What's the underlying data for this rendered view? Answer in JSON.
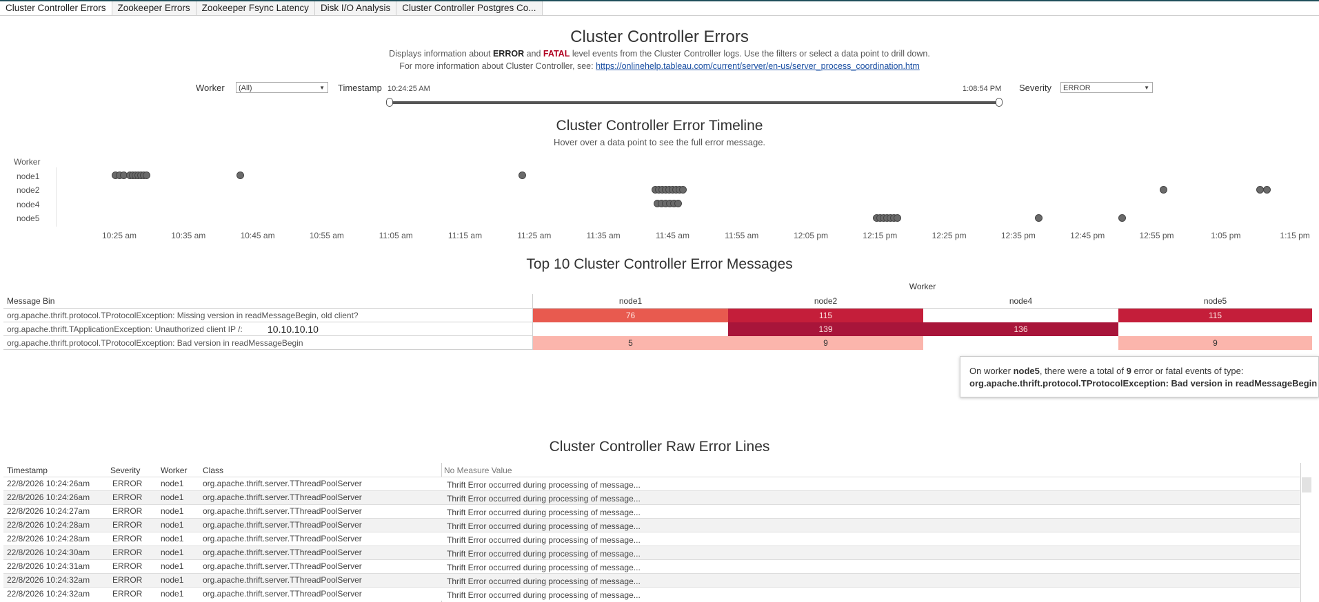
{
  "tabs": [
    "Cluster Controller Errors",
    "Zookeeper Errors",
    "Zookeeper Fsync Latency",
    "Disk I/O Analysis",
    "Cluster Controller Postgres Co..."
  ],
  "header": {
    "title": "Cluster Controller Errors",
    "desc1_pre": "Displays information about ",
    "desc1_error": "ERROR",
    "desc1_and": " and ",
    "desc1_fatal": "FATAL",
    "desc1_post": " level events from the Cluster Controller logs.  Use the filters or select a data point to drill down.",
    "desc2_pre": "For more information about Cluster Controller, see: ",
    "desc2_link": "https://onlinehelp.tableau.com/current/server/en-us/server_process_coordination.htm"
  },
  "filters": {
    "worker_label": "Worker",
    "worker_value": "(All)",
    "timestamp_label": "Timestamp",
    "timestamp_start": "10:24:25 AM",
    "timestamp_end": "1:08:54 PM",
    "severity_label": "Severity",
    "severity_value": "ERROR"
  },
  "timeline": {
    "title": "Cluster Controller Error Timeline",
    "subtitle": "Hover over a data point to see the full error message.",
    "row_header": "Worker",
    "rows": [
      "node1",
      "node2",
      "node4",
      "node5"
    ],
    "ticks": [
      "10:25 am",
      "10:35 am",
      "10:45 am",
      "10:55 am",
      "11:05 am",
      "11:15 am",
      "11:25 am",
      "11:35 am",
      "11:45 am",
      "11:55 am",
      "12:05 pm",
      "12:15 pm",
      "12:25 pm",
      "12:35 pm",
      "12:45 pm",
      "12:55 pm",
      "1:05 pm",
      "1:15 pm"
    ],
    "points_min_after_1025": {
      "node1": [
        -0.5,
        0,
        0.6,
        1.5,
        1.9,
        2.3,
        2.7,
        3.1,
        3.5,
        3.9,
        17.5,
        58.3
      ],
      "node2": [
        77.5,
        78.0,
        78.5,
        79.0,
        79.5,
        80.0,
        80.5,
        81.0,
        81.5,
        151,
        165,
        166
      ],
      "node4": [
        77.8,
        78.4,
        79.0,
        79.6,
        80.2,
        80.8
      ],
      "node5": [
        109.5,
        110.0,
        110.5,
        111.0,
        111.5,
        112.0,
        112.5,
        133.0,
        145.0
      ]
    }
  },
  "heatmap": {
    "title": "Top 10 Cluster Controller Error Messages",
    "group_header": "Worker",
    "row_header": "Message Bin",
    "columns": [
      "node1",
      "node2",
      "node4",
      "node5"
    ],
    "rows": [
      {
        "label": "org.apache.thrift.protocol.TProtocolException: Missing version in readMessageBegin, old client?",
        "values": [
          "76",
          "115",
          "",
          "115"
        ]
      },
      {
        "label": "org.apache.thrift.TApplicationException: Unauthorized client IP /:",
        "values": [
          "",
          "139",
          "136",
          ""
        ]
      },
      {
        "label": "org.apache.thrift.protocol.TProtocolException: Bad version in readMessageBegin",
        "values": [
          "5",
          "9",
          "",
          "9"
        ]
      }
    ],
    "inline_ip": "10.10.10.10",
    "colors": {
      "76": "#e85a4f",
      "115": "#c41e3a",
      "139": "#a8153a",
      "136": "#a8153a",
      "5": "#fbb5ac",
      "9": "#fbb5ac"
    }
  },
  "tooltip": {
    "pre": "On worker ",
    "worker": "node5",
    "mid": ", there were a total of ",
    "count": "9",
    "post": " error or fatal events of type:",
    "type": "org.apache.thrift.protocol.TProtocolException: Bad version in readMessageBegin"
  },
  "raw": {
    "title": "Cluster Controller Raw Error Lines",
    "headers": [
      "Timestamp",
      "Severity",
      "Worker",
      "Class",
      "No Measure Value"
    ],
    "rows": [
      [
        "22/8/2026 10:24:26am",
        "ERROR",
        "node1",
        "org.apache.thrift.server.TThreadPoolServer",
        "Thrift Error occurred during processing of message..."
      ],
      [
        "22/8/2026 10:24:26am",
        "ERROR",
        "node1",
        "org.apache.thrift.server.TThreadPoolServer",
        "Thrift Error occurred during processing of message..."
      ],
      [
        "22/8/2026 10:24:27am",
        "ERROR",
        "node1",
        "org.apache.thrift.server.TThreadPoolServer",
        "Thrift Error occurred during processing of message..."
      ],
      [
        "22/8/2026 10:24:28am",
        "ERROR",
        "node1",
        "org.apache.thrift.server.TThreadPoolServer",
        "Thrift Error occurred during processing of message..."
      ],
      [
        "22/8/2026 10:24:28am",
        "ERROR",
        "node1",
        "org.apache.thrift.server.TThreadPoolServer",
        "Thrift Error occurred during processing of message..."
      ],
      [
        "22/8/2026 10:24:30am",
        "ERROR",
        "node1",
        "org.apache.thrift.server.TThreadPoolServer",
        "Thrift Error occurred during processing of message..."
      ],
      [
        "22/8/2026 10:24:31am",
        "ERROR",
        "node1",
        "org.apache.thrift.server.TThreadPoolServer",
        "Thrift Error occurred during processing of message..."
      ],
      [
        "22/8/2026 10:24:32am",
        "ERROR",
        "node1",
        "org.apache.thrift.server.TThreadPoolServer",
        "Thrift Error occurred during processing of message..."
      ],
      [
        "22/8/2026 10:24:32am",
        "ERROR",
        "node1",
        "org.apache.thrift.server.TThreadPoolServer",
        "Thrift Error occurred during processing of message..."
      ]
    ]
  }
}
